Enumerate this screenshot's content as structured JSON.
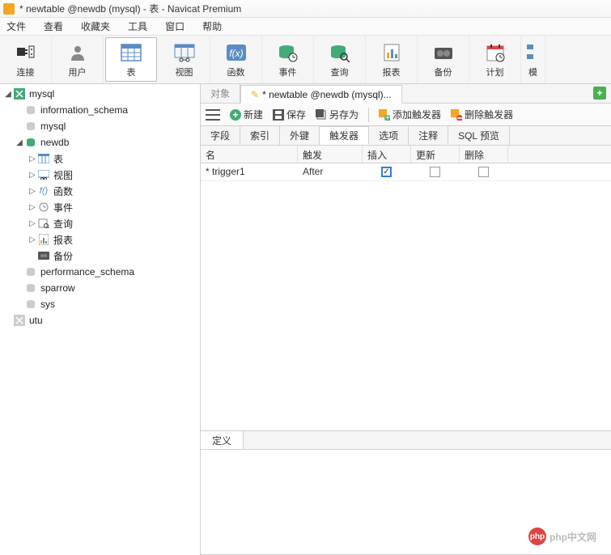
{
  "window": {
    "title": "* newtable @newdb (mysql) - 表 - Navicat Premium"
  },
  "menu": {
    "file": "文件",
    "view": "查看",
    "fav": "收藏夹",
    "tool": "工具",
    "win": "窗口",
    "help": "帮助"
  },
  "toolbar": {
    "connect": "连接",
    "user": "用户",
    "table": "表",
    "view_btn": "视图",
    "func": "函数",
    "event": "事件",
    "query": "查询",
    "report": "报表",
    "backup": "备份",
    "plan": "计划",
    "model": "模"
  },
  "tree": {
    "mysql": "mysql",
    "info_schema": "information_schema",
    "mysql_db": "mysql",
    "newdb": "newdb",
    "tables": "表",
    "views": "视图",
    "funcs": "函数",
    "events": "事件",
    "queries": "查询",
    "reports": "报表",
    "backups": "备份",
    "perf_schema": "performance_schema",
    "sparrow": "sparrow",
    "sys": "sys",
    "utu": "utu"
  },
  "tabs": {
    "objects": "对象",
    "editing": "* newtable @newdb (mysql)..."
  },
  "actions": {
    "new": "新建",
    "save": "保存",
    "saveas": "另存为",
    "addtrig": "添加触发器",
    "deltrig": "删除触发器"
  },
  "subtabs": {
    "field": "字段",
    "index": "索引",
    "fk": "外键",
    "trigger": "触发器",
    "option": "选项",
    "comment": "注释",
    "sqlpreview": "SQL 预览"
  },
  "grid": {
    "h_name": "名",
    "h_trigger": "触发",
    "h_insert": "插入",
    "h_update": "更新",
    "h_delete": "删除",
    "row1": {
      "name": "* trigger1",
      "trigger": "After",
      "insert": true,
      "update": false,
      "delete": false
    }
  },
  "def": {
    "tab": "定义"
  },
  "watermark": "php中文网"
}
